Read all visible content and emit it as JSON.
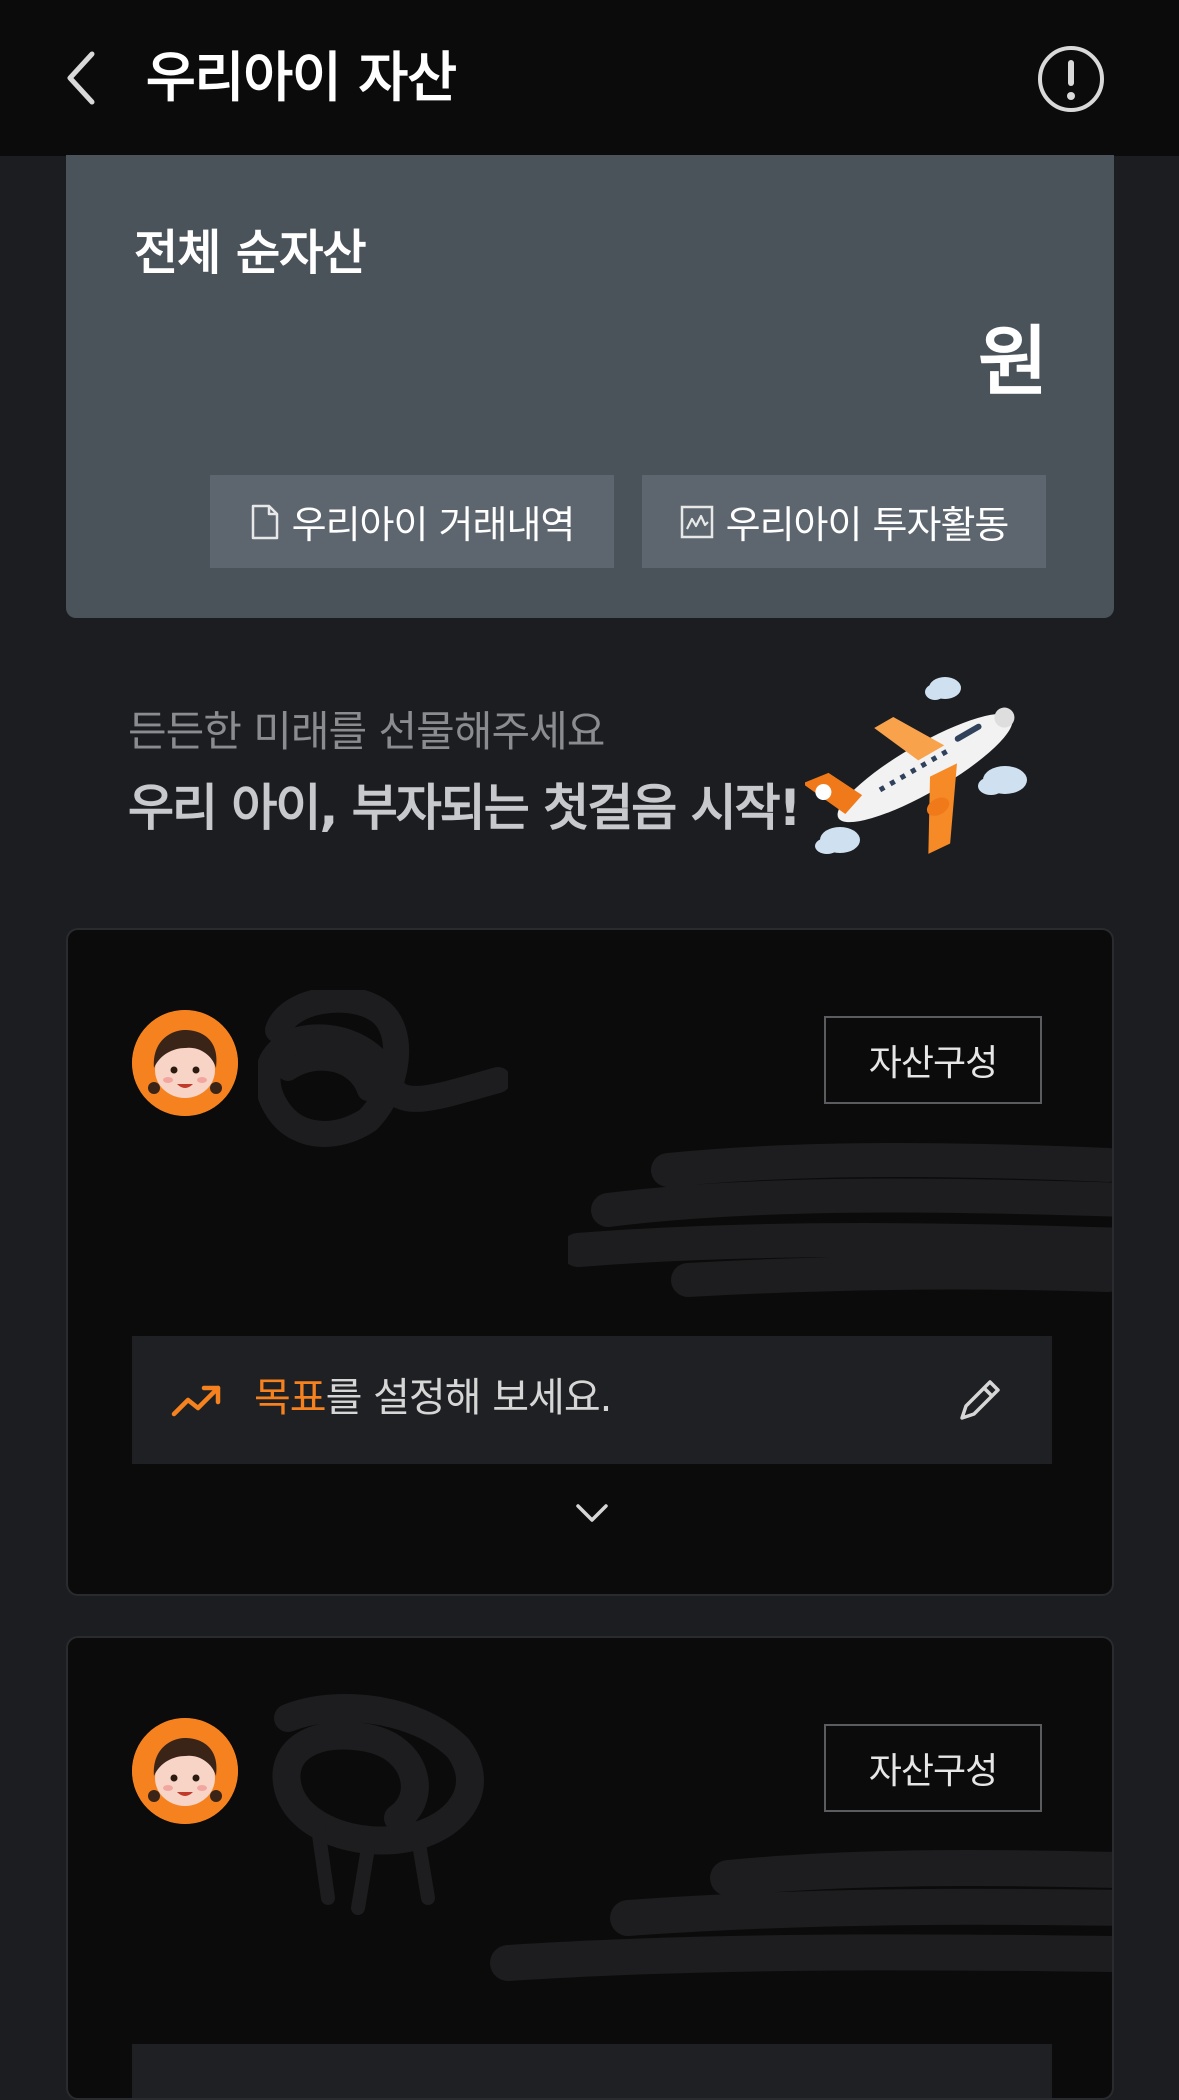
{
  "header": {
    "title": "우리아이 자산"
  },
  "asset_card": {
    "title": "전체 순자산",
    "amount_unit": "원",
    "buttons": {
      "history_label": "우리아이 거래내역",
      "invest_label": "우리아이 투자활동"
    }
  },
  "promo": {
    "subtitle": "든든한 미래를 선물해주세요",
    "headline": "우리 아이, 부자되는 첫걸음 시작!"
  },
  "children": [
    {
      "composition_label": "자산구성",
      "goal_highlight": "목표",
      "goal_rest": "를 설정해 보세요."
    },
    {
      "composition_label": "자산구성"
    }
  ],
  "colors": {
    "accent": "#f5821f",
    "card_bg": "#4a525a",
    "background": "#1c1d20",
    "header_bg": "#0b0b0b"
  }
}
